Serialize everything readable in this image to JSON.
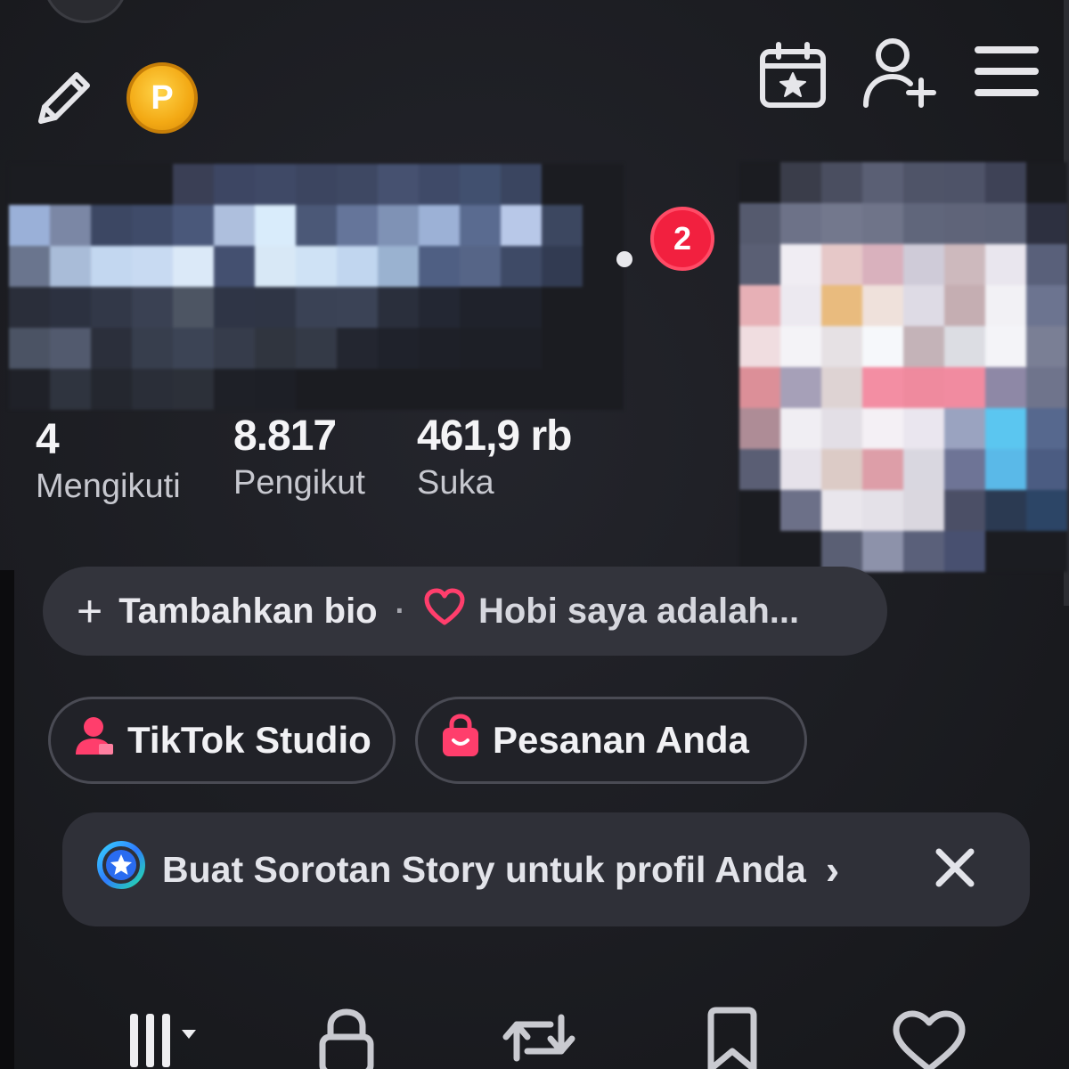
{
  "header": {
    "edit_icon": "pencil-icon",
    "coin_label": "P",
    "calendar_icon": "calendar-star-icon",
    "add_friend_icon": "add-user-icon",
    "menu_icon": "hamburger-menu-icon"
  },
  "profile": {
    "notification_count": "2"
  },
  "stats": [
    {
      "value": "4",
      "label": "Mengikuti"
    },
    {
      "value": "8.817",
      "label": "Pengikut"
    },
    {
      "value": "461,9 rb",
      "label": "Suka"
    }
  ],
  "bio": {
    "add_label": "Tambahkan bio",
    "separator": "·",
    "hobby_label": "Hobi saya adalah..."
  },
  "actions": {
    "studio_label": "TikTok Studio",
    "orders_label": "Pesanan Anda"
  },
  "banner": {
    "text": "Buat Sorotan Story untuk profil Anda",
    "chevron": "›"
  },
  "tabs": [
    "grid-icon",
    "lock-icon",
    "repost-icon",
    "bookmark-icon",
    "heart-icon"
  ],
  "colors": {
    "background": "#1b1c21",
    "badge": "#f2203f",
    "coin": "#f3a914",
    "accent_pink": "#ff3e6c"
  }
}
